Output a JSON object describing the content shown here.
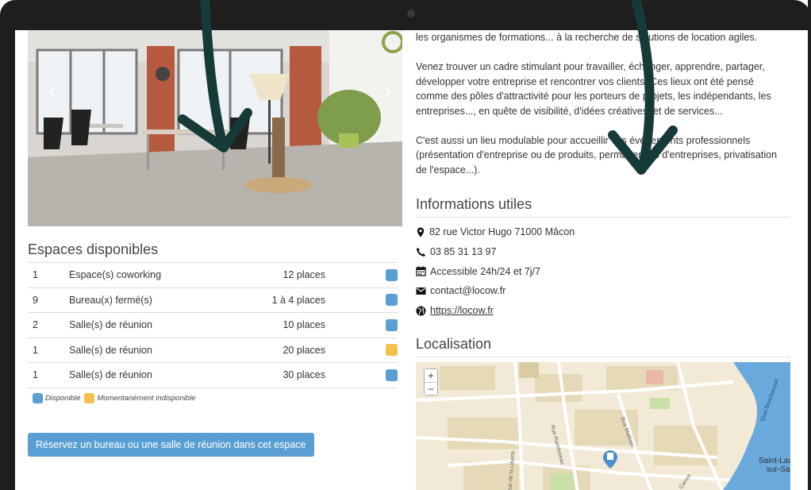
{
  "description": {
    "paragraphs": [
      "les organismes de formations... à la recherche de solutions de location agiles.",
      "Venez trouver un cadre stimulant pour travailler, échanger, apprendre, partager, développer votre entreprise et rencontrer vos clients. Ces lieux ont été pensé comme des pôles d'attractivité pour les porteurs de projets, les indépendants, les entreprises..., en quête de visibilité, d'idées créatives, et de services...",
      "C'est aussi un lieu modulable pour accueillir vos événements professionnels (présentation d'entreprise ou de produits, permanences d'entreprises, privatisation de l'espace...)."
    ]
  },
  "espaces": {
    "title": "Espaces disponibles",
    "rows": [
      {
        "qty": "1",
        "type": "Espace(s) coworking",
        "places": "12 places",
        "status": "disponible"
      },
      {
        "qty": "9",
        "type": "Bureau(x) fermé(s)",
        "places": "1 à 4 places",
        "status": "disponible"
      },
      {
        "qty": "2",
        "type": "Salle(s) de réunion",
        "places": "10 places",
        "status": "disponible"
      },
      {
        "qty": "1",
        "type": "Salle(s) de réunion",
        "places": "20 places",
        "status": "indisponible"
      },
      {
        "qty": "1",
        "type": "Salle(s) de réunion",
        "places": "30 places",
        "status": "disponible"
      }
    ],
    "legend": {
      "available": "Disponible",
      "unavailable": "Momentanément indisponible"
    },
    "reserve_button": "Réservez un bureau ou une salle de réunion dans cet espace"
  },
  "info": {
    "title": "Informations utiles",
    "address": "82 rue Victor Hugo 71000 Mâcon",
    "phone": "03 85 31 13 97",
    "hours": "Accessible 24h/24 et 7j/7",
    "email": "contact@locow.fr",
    "website": "https://locow.fr"
  },
  "localisation": {
    "title": "Localisation",
    "zoom_in": "+",
    "zoom_out": "−",
    "labels": {
      "saint_laurent_1": "Saint-Lau",
      "saint_laurent_2": "sur-Sa",
      "street_1": "Rue Rambuteau",
      "street_2": "Rue Mathieu",
      "street_3": "Rue de la Liberté",
      "street_4": "Quai Bouchacourt",
      "street_5": "Carnot"
    }
  },
  "carousel": {
    "prev": "‹",
    "next": "›"
  },
  "colors": {
    "available": "#5a9fd4",
    "unavailable": "#f5c04a",
    "button": "#5a9fd4",
    "river": "#6aa9dc",
    "arrow": "#163a37"
  }
}
